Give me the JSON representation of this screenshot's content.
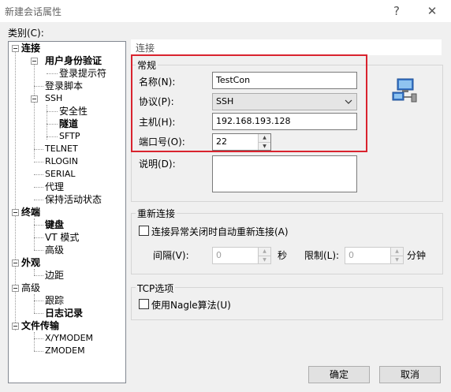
{
  "window": {
    "title": "新建会话属性",
    "help_glyph": "?",
    "close_glyph": "✕"
  },
  "category_label": "类别(C):",
  "tree": {
    "connection": "连接",
    "user_auth": "用户身份验证",
    "login_prompt": "登录提示符",
    "login_script": "登录脚本",
    "ssh": "SSH",
    "security": "安全性",
    "tunnel": "隧道",
    "sftp": "SFTP",
    "telnet": "TELNET",
    "rlogin": "RLOGIN",
    "serial": "SERIAL",
    "proxy": "代理",
    "keepalive": "保持活动状态",
    "terminal": "终端",
    "keyboard": "键盘",
    "vt_mode": "VT 模式",
    "advanced_term": "高级",
    "appearance": "外观",
    "margin": "边距",
    "advanced": "高级",
    "trace": "跟踪",
    "log": "日志记录",
    "file_transfer": "文件传输",
    "xymodem": "X/YMODEM",
    "zmodem": "ZMODEM"
  },
  "panel_title": "连接",
  "general": {
    "legend": "常规",
    "name_label": "名称(N):",
    "name_value": "TestCon",
    "protocol_label": "协议(P):",
    "protocol_value": "SSH",
    "host_label": "主机(H):",
    "host_value": "192.168.193.128",
    "port_label": "端口号(O):",
    "port_value": "22",
    "desc_label": "说明(D):",
    "desc_value": ""
  },
  "reconnect": {
    "legend": "重新连接",
    "auto_label": "连接异常关闭时自动重新连接(A)",
    "interval_label": "间隔(V):",
    "interval_value": "0",
    "sec_unit": "秒",
    "limit_label": "限制(L):",
    "limit_value": "0",
    "min_unit": "分钟"
  },
  "tcp": {
    "legend": "TCP选项",
    "nagle_label": "使用Nagle算法(U)"
  },
  "buttons": {
    "ok": "确定",
    "cancel": "取消"
  },
  "colors": {
    "highlight": "#d9232e"
  }
}
